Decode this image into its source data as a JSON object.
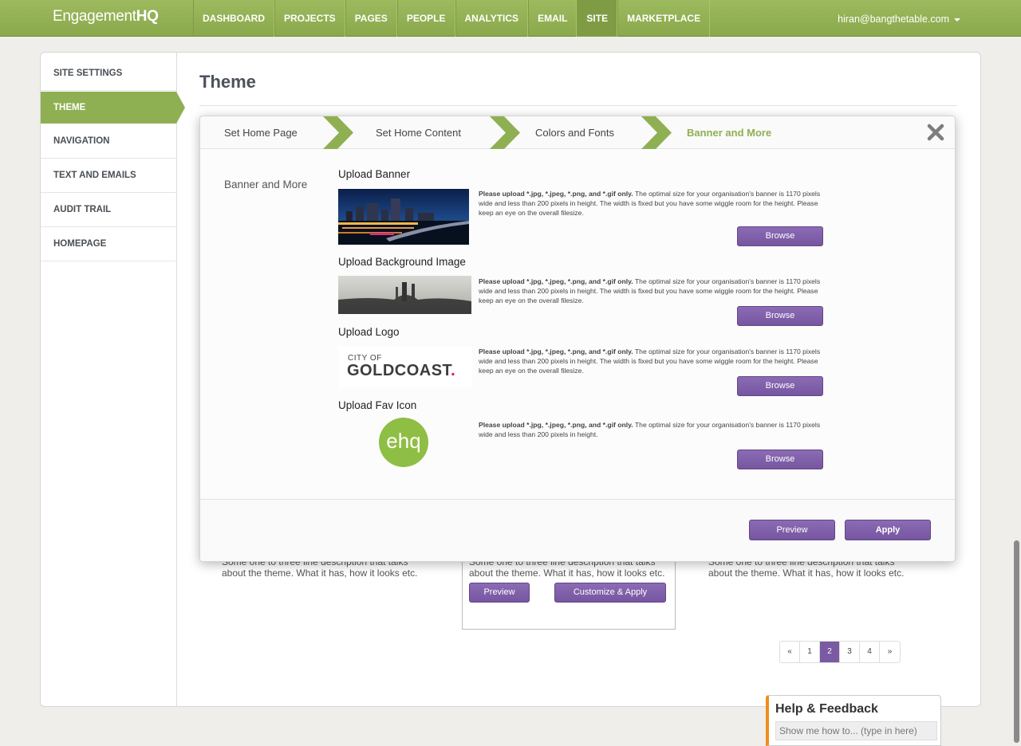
{
  "brand": {
    "logo_prefix": "Engagement",
    "logo_suffix": "HQ"
  },
  "nav": {
    "items": [
      "DASHBOARD",
      "PROJECTS",
      "PAGES",
      "PEOPLE",
      "ANALYTICS",
      "EMAIL",
      "SITE",
      "MARKETPLACE"
    ],
    "active": "SITE",
    "user_email": "hiran@bangthetable.com"
  },
  "sidebar": {
    "items": [
      {
        "label": "SITE SETTINGS"
      },
      {
        "label": "THEME"
      },
      {
        "label": "NAVIGATION"
      },
      {
        "label": "TEXT AND EMAILS"
      },
      {
        "label": "AUDIT TRAIL"
      },
      {
        "label": "HOMEPAGE"
      }
    ],
    "active": "THEME"
  },
  "page": {
    "title": "Theme"
  },
  "themes": {
    "description": "Some one to three line description that talks about the theme. What it has, how it looks etc.",
    "preview_label": "Preview",
    "customize_label": "Customize & Apply"
  },
  "pagination": {
    "items": [
      "«",
      "1",
      "2",
      "3",
      "4",
      "»"
    ],
    "current": "2"
  },
  "wizard": {
    "steps": [
      "Set Home Page",
      "Set Home Content",
      "Colors and Fonts",
      "Banner and More"
    ],
    "current_step": "Banner and More",
    "section_label": "Banner and More",
    "help_bold": "Please upload *.jpg, *.jpeg, *.png, and *.gif only.",
    "help_text_full": "The optimal size for your organisation's banner is 1170 pixels wide and less than 200 pixels in height. The width is fixed but you have some wiggle room for the height. Please keep an eye on the overall filesize.",
    "help_text_short": "The optimal size for your organisation's banner is 1170 pixels wide and less than 200 pixels in height.",
    "uploads": [
      {
        "title": "Upload Banner",
        "browse_label": "Browse"
      },
      {
        "title": "Upload Background Image",
        "browse_label": "Browse"
      },
      {
        "title": "Upload Logo",
        "browse_label": "Browse",
        "logo_line1": "CITY OF",
        "logo_line2": "GOLDCOAST"
      },
      {
        "title": "Upload Fav Icon",
        "browse_label": "Browse",
        "icon_text": "ehq"
      }
    ],
    "preview_label": "Preview",
    "apply_label": "Apply"
  },
  "help_widget": {
    "title": "Help & Feedback",
    "input_placeholder": "Show me how to... (type in here)"
  },
  "colors": {
    "brand_green": "#8fb052",
    "accent_purple": "#7a5aa3",
    "help_orange": "#f08c1e"
  }
}
